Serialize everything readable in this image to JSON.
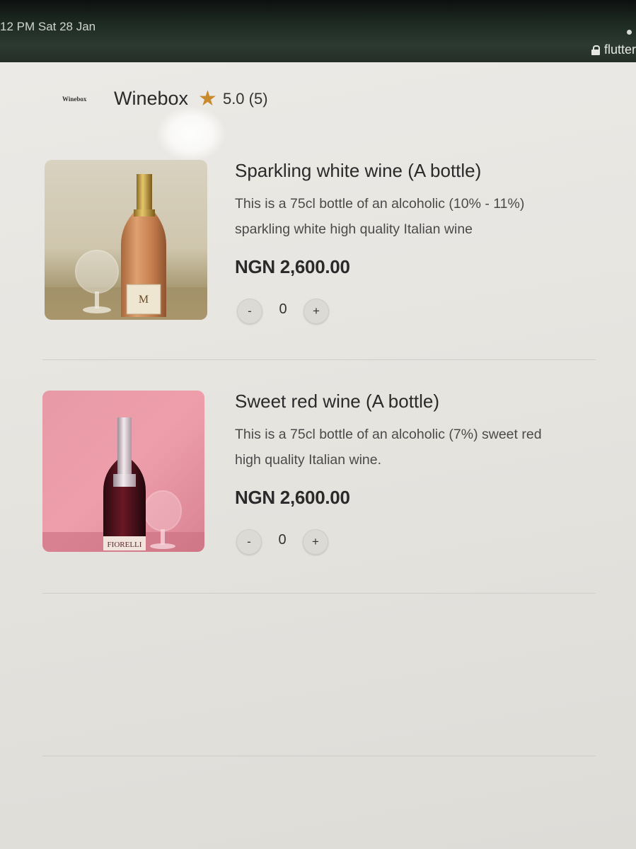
{
  "status_bar": {
    "time_date": "12 PM   Sat 28 Jan",
    "url": "flutter"
  },
  "store": {
    "logo_text": "Winebox",
    "name": "Winebox",
    "rating": "5.0 (5)"
  },
  "products": [
    {
      "title": "Sparkling white wine (A bottle)",
      "description": "This is a 75cl bottle of an alcoholic (10% - 11%) sparkling white high quality Italian wine",
      "price": "NGN 2,600.00",
      "quantity": "0",
      "minus_label": "-",
      "plus_label": "+",
      "label_text": "M"
    },
    {
      "title": "Sweet red wine (A bottle)",
      "description": "This is a 75cl bottle of an alcoholic (7%) sweet red high quality Italian wine.",
      "price": "NGN 2,600.00",
      "quantity": "0",
      "minus_label": "-",
      "plus_label": "+",
      "label_text": "FIORELLI"
    }
  ],
  "colors": {
    "star": "#c98a2c",
    "page_background": "#e6e4df",
    "divider": "#cfcdc8"
  }
}
